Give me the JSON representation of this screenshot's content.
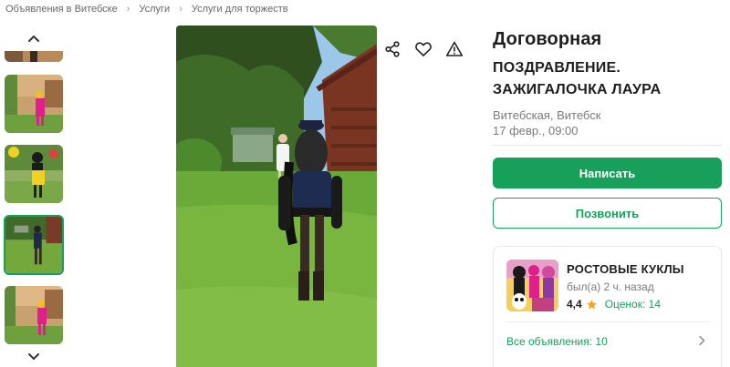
{
  "breadcrumb": [
    {
      "label": "Объявления в Витебске"
    },
    {
      "label": "Услуги"
    },
    {
      "label": "Услуги для торжеств"
    }
  ],
  "thumbnails": {
    "count_visible": 5,
    "active_index": 3,
    "up_icon": "chevron-up-icon",
    "down_icon": "chevron-down-icon"
  },
  "photo_actions": {
    "share_icon": "share-icon",
    "favorite_icon": "heart-icon",
    "report_icon": "warning-icon"
  },
  "ad": {
    "price": "Договорная",
    "title": "ПОЗДРАВЛЕНИЕ. ЗАЖИГАЛОЧКА ЛАУРА",
    "location": "Витебская, Витебск",
    "date": "17 февр., 09:00"
  },
  "actions": {
    "write_label": "Написать",
    "call_label": "Позвонить"
  },
  "seller": {
    "name": "РОСТОВЫЕ КУКЛЫ",
    "last_seen": "был(а) 2 ч. назад",
    "rating": "4,4",
    "reviews": "Оценок: 14",
    "all_ads": "Все объявления: 10"
  },
  "colors": {
    "accent": "#16a05a",
    "star": "#f5a623",
    "text_primary": "#1e1e1e",
    "text_secondary": "#7a7a7a"
  }
}
